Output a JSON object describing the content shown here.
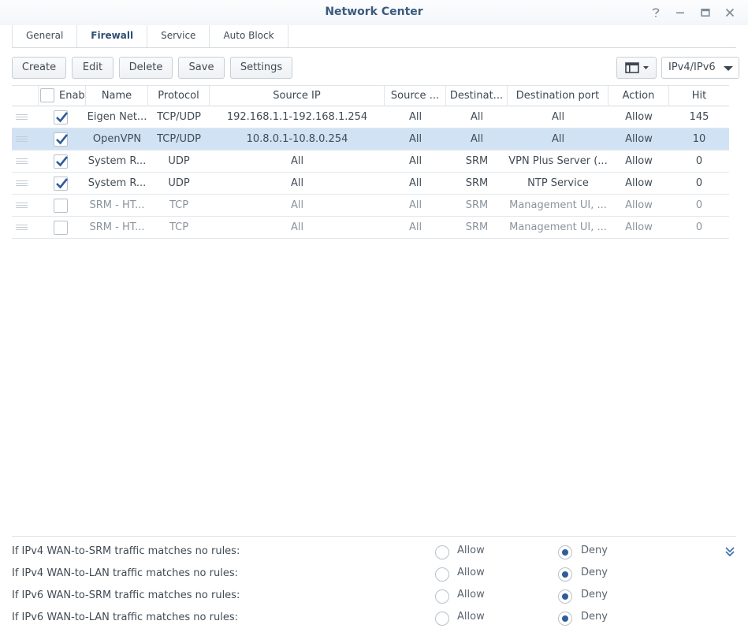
{
  "window": {
    "title": "Network Center"
  },
  "tabs": [
    {
      "label": "General"
    },
    {
      "label": "Firewall"
    },
    {
      "label": "Service"
    },
    {
      "label": "Auto Block"
    }
  ],
  "toolbar": {
    "create": "Create",
    "edit": "Edit",
    "delete": "Delete",
    "save": "Save",
    "settings": "Settings",
    "ip_version": "IPv4/IPv6"
  },
  "table": {
    "headers": [
      "Enabl",
      "Name",
      "Protocol",
      "Source IP",
      "Source ...",
      "Destinat...",
      "Destination port",
      "Action",
      "Hit"
    ],
    "rows": [
      {
        "enabled": true,
        "name": "Eigen Net...",
        "protocol": "TCP/UDP",
        "source_ip": "192.168.1.1-192.168.1.254",
        "source": "All",
        "destination": "All",
        "dest_port": "All",
        "action": "Allow",
        "hit": "145"
      },
      {
        "enabled": true,
        "name": "OpenVPN",
        "protocol": "TCP/UDP",
        "source_ip": "10.8.0.1-10.8.0.254",
        "source": "All",
        "destination": "All",
        "dest_port": "All",
        "action": "Allow",
        "hit": "10"
      },
      {
        "enabled": true,
        "name": "System R...",
        "protocol": "UDP",
        "source_ip": "All",
        "source": "All",
        "destination": "SRM",
        "dest_port": "VPN Plus Server (...",
        "action": "Allow",
        "hit": "0"
      },
      {
        "enabled": true,
        "name": "System R...",
        "protocol": "UDP",
        "source_ip": "All",
        "source": "All",
        "destination": "SRM",
        "dest_port": "NTP Service",
        "action": "Allow",
        "hit": "0"
      },
      {
        "enabled": false,
        "name": "SRM - HT...",
        "protocol": "TCP",
        "source_ip": "All",
        "source": "All",
        "destination": "SRM",
        "dest_port": "Management UI, ...",
        "action": "Allow",
        "hit": "0"
      },
      {
        "enabled": false,
        "name": "SRM - HT...",
        "protocol": "TCP",
        "source_ip": "All",
        "source": "All",
        "destination": "SRM",
        "dest_port": "Management UI, ...",
        "action": "Allow",
        "hit": "0"
      }
    ]
  },
  "default_policies": {
    "allow_label": "Allow",
    "deny_label": "Deny",
    "items": [
      {
        "label": "If IPv4 WAN-to-SRM traffic matches no rules:",
        "selected": "Deny"
      },
      {
        "label": "If IPv4 WAN-to-LAN traffic matches no rules:",
        "selected": "Deny"
      },
      {
        "label": "If IPv6 WAN-to-SRM traffic matches no rules:",
        "selected": "Deny"
      },
      {
        "label": "If IPv6 WAN-to-LAN traffic matches no rules:",
        "selected": "Deny"
      }
    ]
  },
  "colors": {
    "accent": "#2f5d9a",
    "selected_row": "#d1e2f4",
    "title": "#3a5a7e"
  }
}
